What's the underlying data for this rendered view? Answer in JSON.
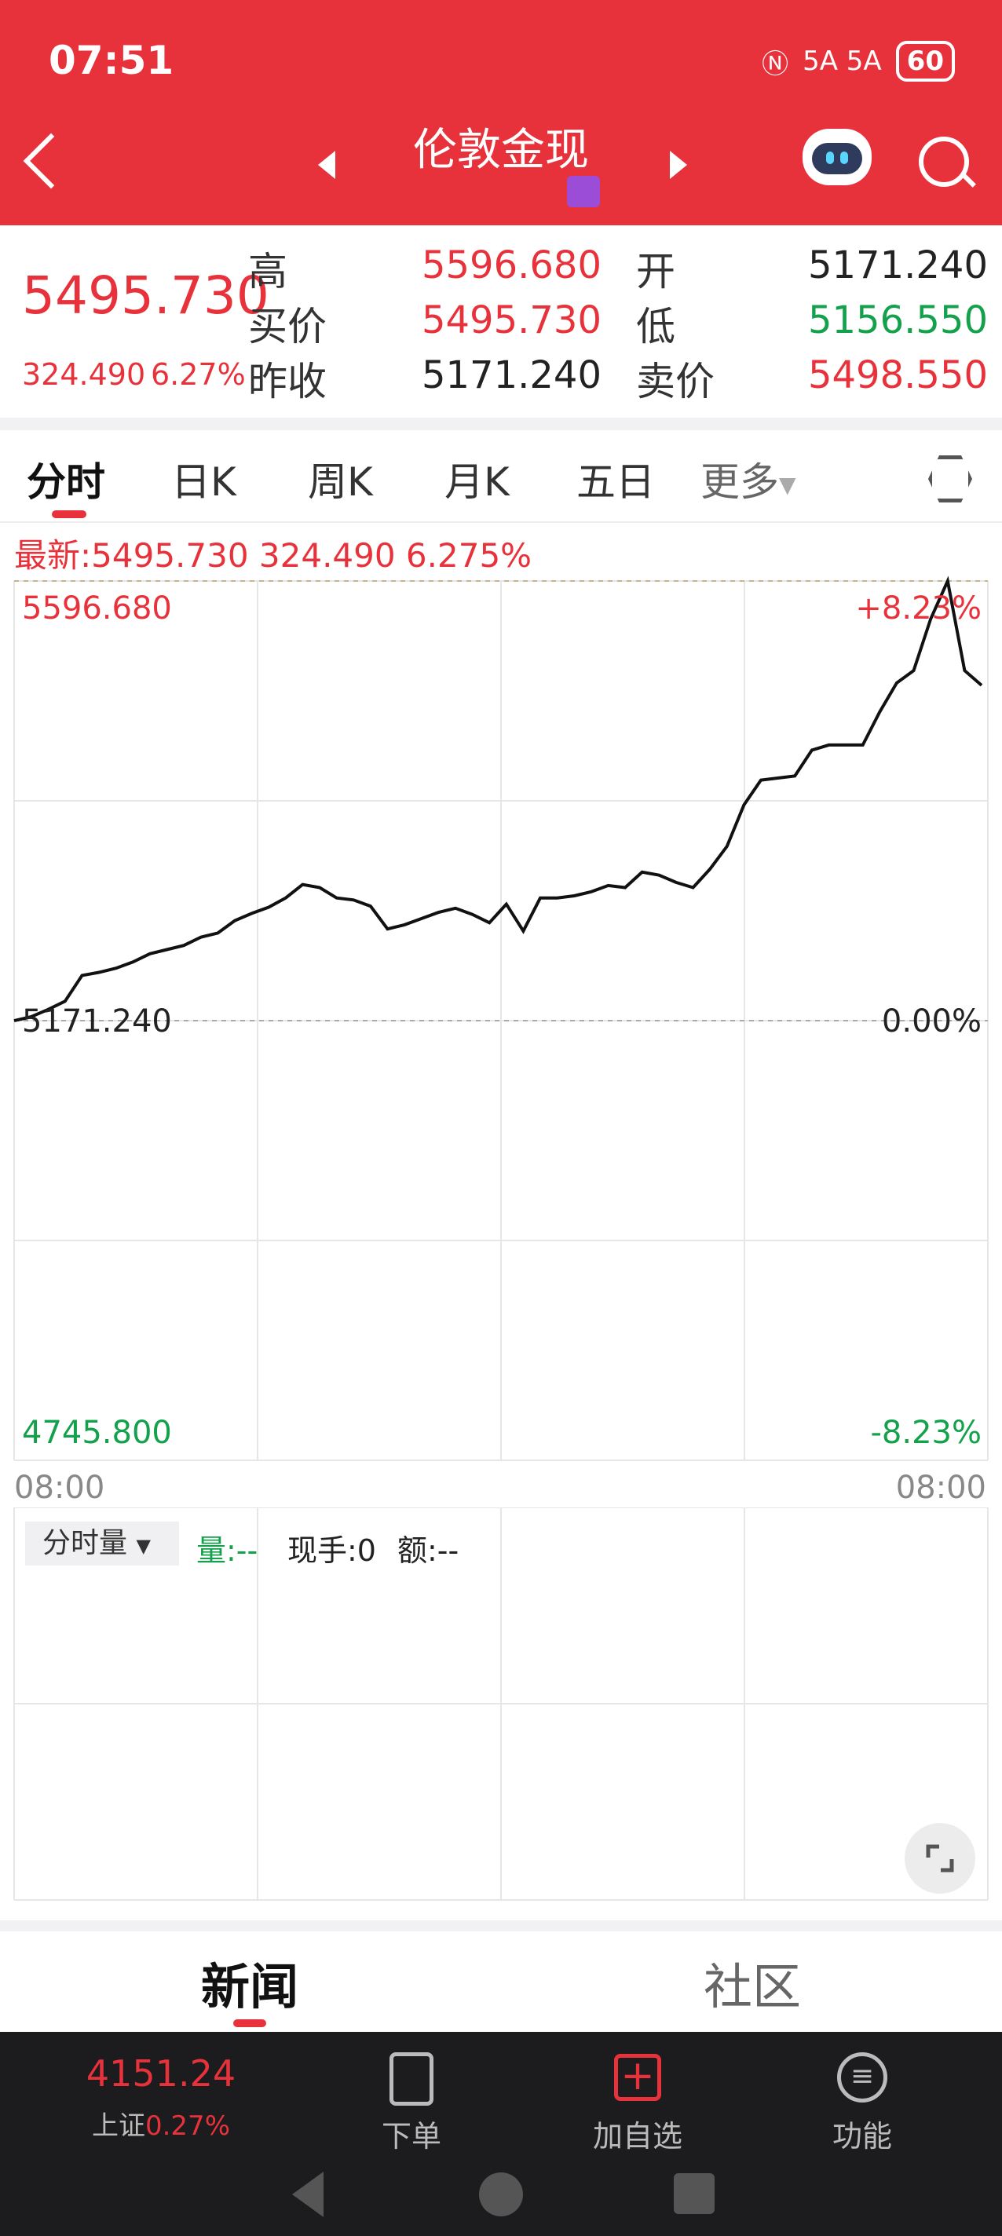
{
  "status": {
    "time": "07:51",
    "network": "5A 5A",
    "battery": "60"
  },
  "header": {
    "title": "伦敦金现"
  },
  "quote": {
    "price": "5495.730",
    "change": "324.490",
    "change_pct": "6.27%",
    "labels": {
      "high": "高",
      "bid": "买价",
      "prev_close": "昨收",
      "open": "开",
      "low": "低",
      "ask": "卖价"
    },
    "values": {
      "high": "5596.680",
      "bid": "5495.730",
      "prev_close": "5171.240",
      "open": "5171.240",
      "low": "5156.550",
      "ask": "5498.550"
    }
  },
  "tabs": [
    "分时",
    "日K",
    "周K",
    "月K",
    "五日",
    "更多"
  ],
  "chart": {
    "latest": "最新:5495.730 324.490 6.275%",
    "top_price": "5596.680",
    "top_pct": "+8.23%",
    "mid_price": "5171.240",
    "mid_pct": "0.00%",
    "bottom_price": "4745.800",
    "bottom_pct": "-8.23%",
    "time_start": "08:00",
    "time_end": "08:00"
  },
  "chart_data": {
    "type": "line",
    "title": "",
    "xlabel": "",
    "ylabel": "",
    "ylim": [
      4745.8,
      5596.68
    ],
    "x_ticks": [
      "08:00",
      "08:00"
    ],
    "reference_line": 5171.24,
    "series": [
      {
        "values": [
          5171.2,
          5175,
          5182,
          5190,
          5215,
          5218,
          5222,
          5228,
          5236,
          5240,
          5244,
          5252,
          5256,
          5268,
          5275,
          5281,
          5290,
          5303,
          5300,
          5290,
          5288,
          5282,
          5260,
          5264,
          5270,
          5276,
          5280,
          5274,
          5266,
          5284,
          5258,
          5290,
          5290,
          5292,
          5296,
          5302,
          5300,
          5315,
          5312,
          5305,
          5300,
          5318,
          5340,
          5380,
          5404,
          5406,
          5408,
          5433,
          5438,
          5438,
          5438,
          5470,
          5498,
          5510,
          5560,
          5596.68,
          5510,
          5495.73
        ]
      }
    ]
  },
  "volume": {
    "select": "分时量",
    "vol_label": "量:--",
    "hand_label": "现手:0",
    "amount_label": "额:--"
  },
  "news_tabs": {
    "news": "新闻",
    "community": "社区"
  },
  "bottom_nav": {
    "index_value": "4151.24",
    "index_name": "上证",
    "index_pct": "0.27%",
    "order": "下单",
    "add_watch": "加自选",
    "functions": "功能"
  }
}
